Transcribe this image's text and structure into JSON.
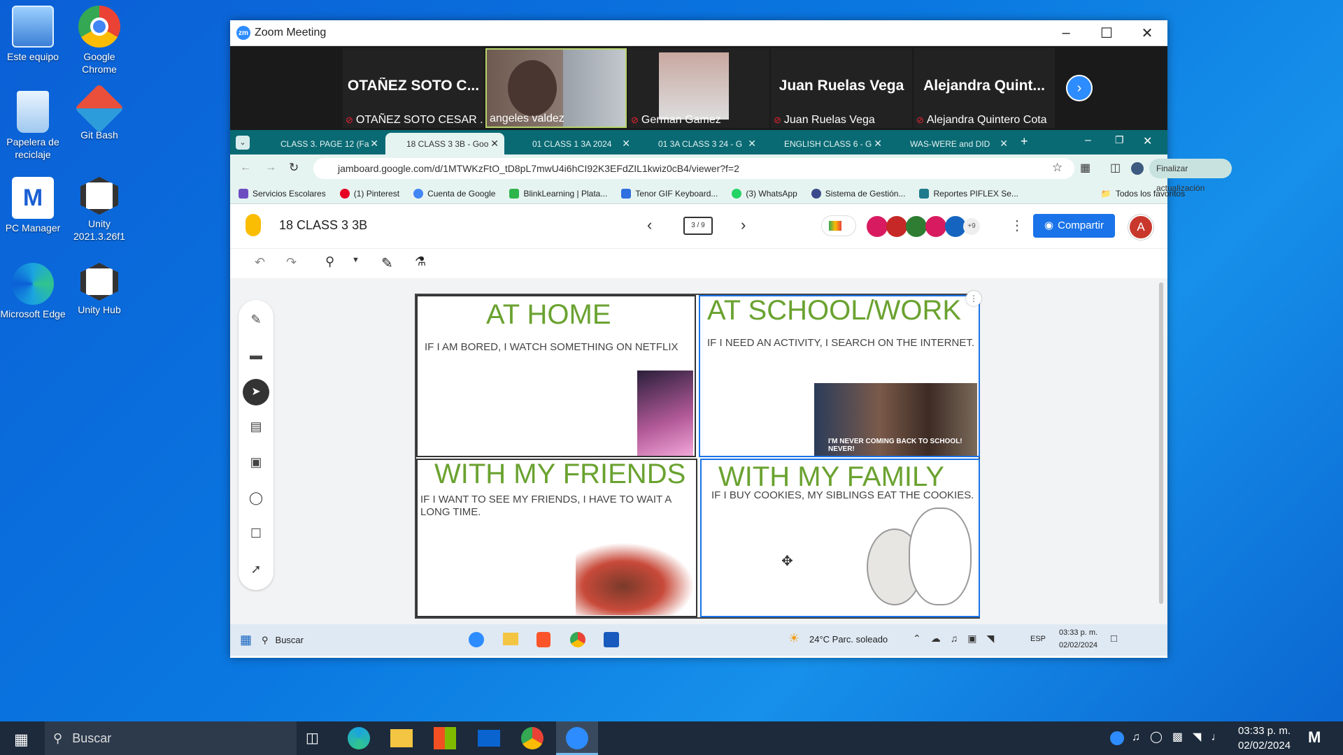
{
  "desktop": {
    "icons": [
      {
        "label": "Este equipo",
        "color": "#7fb8ee"
      },
      {
        "label": "Google Chrome",
        "color": "#ffffff"
      },
      {
        "label": "Papelera de reciclaje",
        "color": "#bfe0ff"
      },
      {
        "label": "Git Bash",
        "color": "#e94f3a"
      },
      {
        "label": "PC Manager",
        "color": "#1b5fd4"
      },
      {
        "label": "Unity 2021.3.26f1",
        "color": "#333333"
      },
      {
        "label": "Microsoft Edge",
        "color": "#1aa4e0"
      },
      {
        "label": "Unity Hub",
        "color": "#333333"
      }
    ]
  },
  "zoom": {
    "title": "Zoom Meeting",
    "logo": "zm",
    "participants": [
      {
        "big": "OTAÑEZ  SOTO  C...",
        "name": "OTAÑEZ SOTO CESAR ..."
      },
      {
        "big": "",
        "name": "angeles valdez"
      },
      {
        "big": "",
        "name": "German Gamez"
      },
      {
        "big": "Juan Ruelas Vega",
        "name": "Juan Ruelas Vega"
      },
      {
        "big": "Alejandra  Quint...",
        "name": "Alejandra Quintero Cota"
      }
    ]
  },
  "chrome": {
    "tabs": [
      {
        "label": "CLASS 3. PAGE 12 (Fa",
        "active": false
      },
      {
        "label": "18 CLASS 3 3B - Goo",
        "active": true
      },
      {
        "label": "01 CLASS 1 3A 2024",
        "active": false
      },
      {
        "label": "01 3A CLASS 3 24 - G",
        "active": false
      },
      {
        "label": "ENGLISH CLASS 6 - G",
        "active": false
      },
      {
        "label": "WAS-WERE and DID",
        "active": false
      }
    ],
    "url": "jamboard.google.com/d/1MTWKzFtO_tD8pL7mwU4i6hCI92K3EFdZIL1kwiz0cB4/viewer?f=2",
    "update_label": "Finalizar actualización",
    "bookmarks": [
      "Servicios Escolares",
      "(1) Pinterest",
      "Cuenta de Google",
      "BlinkLearning | Plata...",
      "Tenor GIF Keyboard...",
      "(3) WhatsApp",
      "Sistema de Gestión...",
      "Reportes PIFLEX Se..."
    ],
    "all_bookmarks": "Todos los favoritos"
  },
  "jamboard": {
    "title": "18 CLASS 3 3B",
    "frame": "3 / 9",
    "more_collaborators": "+9",
    "share_label": "Compartir",
    "avatar_letter": "A",
    "panels": [
      {
        "heading": "AT HOME",
        "text": "IF I AM BORED, I WATCH SOMETHING ON NETFLIX"
      },
      {
        "heading": "AT SCHOOL/WORK",
        "text": "IF I NEED AN ACTIVITY, I SEARCH ON THE INTERNET.",
        "caption": "I'M NEVER COMING BACK TO SCHOOL! NEVER!"
      },
      {
        "heading": "WITH MY FRIENDS",
        "text": "IF I WANT TO SEE MY FRIENDS, I HAVE TO WAIT A LONG TIME."
      },
      {
        "heading": "WITH MY FAMILY",
        "text": "IF I BUY COOKIES, MY SIBLINGS EAT THE COOKIES."
      }
    ]
  },
  "inner_taskbar": {
    "search": "Buscar",
    "weather": "24°C  Parc. soleado",
    "lang": "ESP",
    "time": "03:33 p. m.",
    "date": "02/02/2024"
  },
  "taskbar": {
    "search": "Buscar",
    "time": "03:33 p. m.",
    "date": "02/02/2024"
  }
}
